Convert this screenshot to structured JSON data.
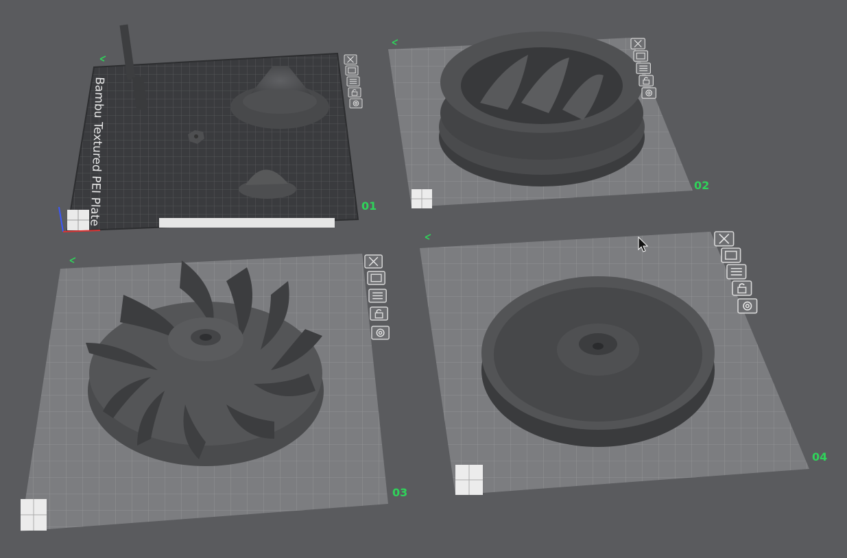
{
  "plates": [
    {
      "label": "01",
      "plate_type": "Bambu Textured PEI Plate",
      "selected": true
    },
    {
      "label": "02"
    },
    {
      "label": "03"
    },
    {
      "label": "04"
    }
  ],
  "plate_buttons": [
    "close-icon",
    "arrange-icon",
    "orient-icon",
    "lock-icon",
    "settings-icon"
  ],
  "colors": {
    "background": "#5a5b5e",
    "plate_grid": "#8a8a8d",
    "plate_textured": "#3a3b3e",
    "label_green": "#2fd35a",
    "model": "#4a4b4d"
  }
}
